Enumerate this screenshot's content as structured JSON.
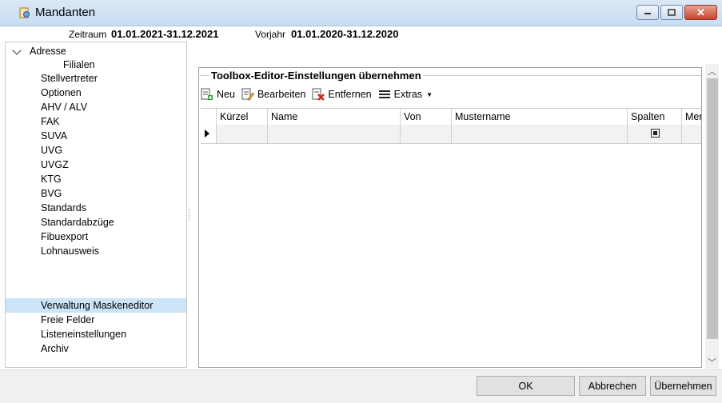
{
  "window": {
    "title": "Mandanten",
    "icon": "mandant-icon",
    "controls": [
      "minimize-icon",
      "maximize-icon",
      "close-icon"
    ]
  },
  "period": {
    "zeitraum_label": "Zeitraum",
    "zeitraum_value": "01.01.2021-31.12.2021",
    "vorjahr_label": "Vorjahr",
    "vorjahr_value": "01.01.2020-31.12.2020"
  },
  "nav": {
    "items": [
      {
        "label": "Adresse"
      },
      {
        "label": "Filialen"
      },
      {
        "label": "Stellvertreter"
      },
      {
        "label": "Optionen"
      },
      {
        "label": "AHV / ALV"
      },
      {
        "label": "FAK"
      },
      {
        "label": "SUVA"
      },
      {
        "label": "UVG"
      },
      {
        "label": "UVGZ"
      },
      {
        "label": "KTG"
      },
      {
        "label": "BVG"
      },
      {
        "label": "Standards"
      },
      {
        "label": "Standardabzüge"
      },
      {
        "label": "Fibuexport"
      },
      {
        "label": "Lohnausweis"
      },
      {
        "label": "Verwaltung Maskeneditor"
      },
      {
        "label": "Freie Felder"
      },
      {
        "label": "Listeneinstellungen"
      },
      {
        "label": "Archiv"
      }
    ],
    "selected": "Verwaltung Maskeneditor"
  },
  "main": {
    "group_title": "Toolbox-Editor-Einstellungen übernehmen",
    "toolbar": {
      "new_label": "Neu",
      "edit_label": "Bearbeiten",
      "delete_label": "Entfernen",
      "extras_label": "Extras"
    },
    "grid": {
      "columns": [
        "Kürzel",
        "Name",
        "Von",
        "Mustername",
        "Spalten",
        "Mer"
      ],
      "rows": [
        {
          "kuerzel": "",
          "name": "",
          "von": "",
          "mustername": "",
          "spalten": true
        }
      ]
    }
  },
  "buttons": {
    "ok": "OK",
    "cancel": "Abbrechen",
    "apply": "Übernehmen"
  },
  "colors": {
    "selection": "#cce4f7",
    "title_bar": "#dbe8f6",
    "close_button": "#c7432a"
  }
}
